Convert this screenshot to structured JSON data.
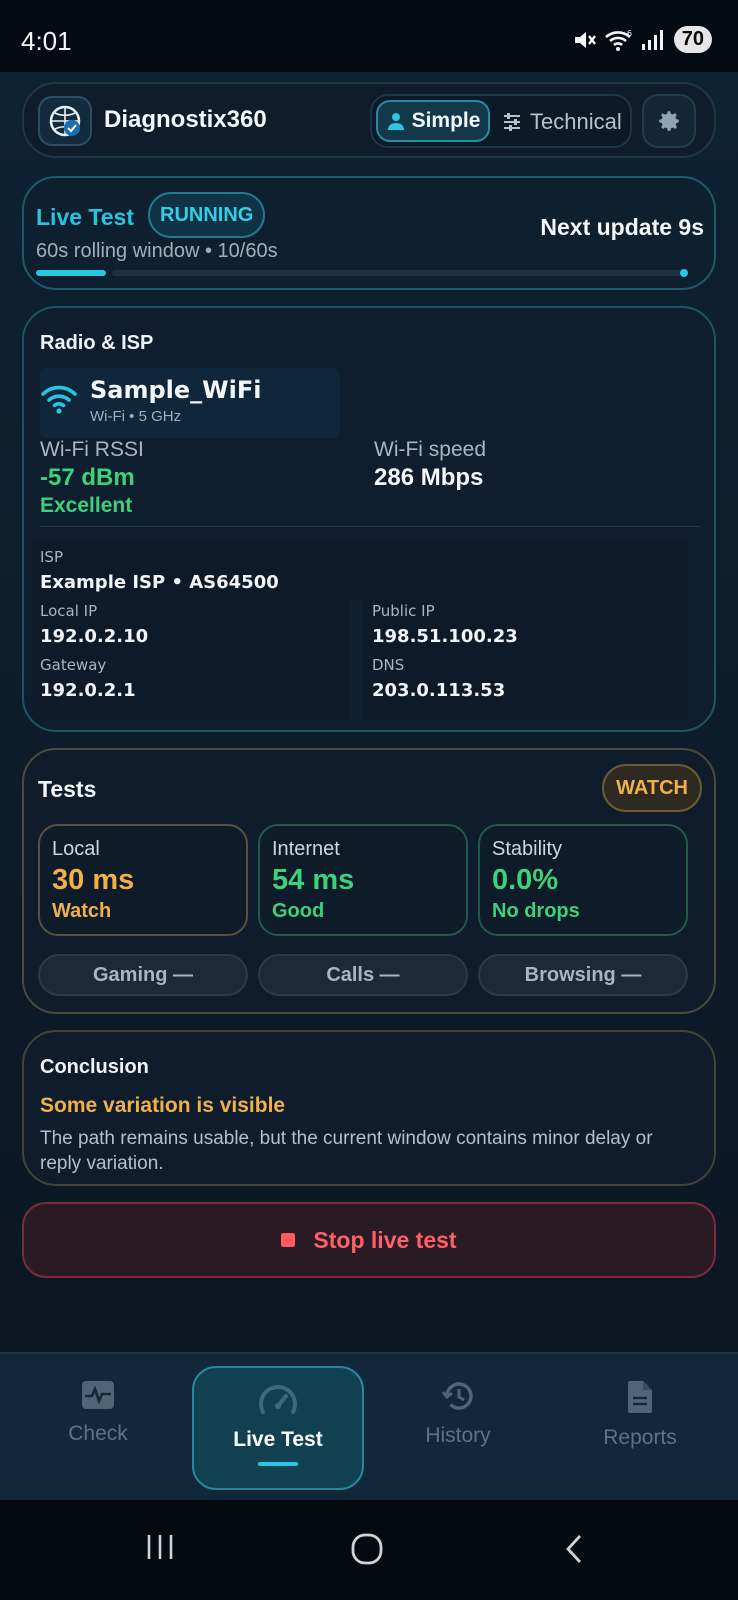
{
  "status_bar": {
    "time": "4:01",
    "battery": "70",
    "icons": [
      "mute-icon",
      "wifi-6-icon",
      "signal-icon"
    ]
  },
  "header": {
    "app_name": "Diagnostix360",
    "mode_simple": "Simple",
    "mode_technical": "Technical",
    "active_mode": "Simple",
    "icons": [
      "app-logo-icon",
      "person-icon",
      "sliders-icon",
      "gear-icon"
    ]
  },
  "live_test": {
    "label": "Live Test",
    "status": "RUNNING",
    "window": "60s rolling window • 10/60s",
    "next_update": "Next update 9s",
    "progress": 0.167
  },
  "radio": {
    "title": "Radio & ISP",
    "ssid": "Sample_WiFi",
    "band": "Wi-Fi • 5 GHz",
    "rssi_label": "Wi-Fi RSSI",
    "rssi_value": "-57 dBm",
    "rssi_quality": "Excellent",
    "speed_label": "Wi-Fi speed",
    "speed_value": "286 Mbps",
    "isp_label": "ISP",
    "isp_value": "Example ISP • AS64500",
    "local_ip_label": "Local IP",
    "local_ip": "192.0.2.10",
    "public_ip_label": "Public IP",
    "public_ip": "198.51.100.23",
    "gateway_label": "Gateway",
    "gateway": "192.0.2.1",
    "dns_label": "DNS",
    "dns": "203.0.113.53"
  },
  "tests": {
    "title": "Tests",
    "badge": "WATCH",
    "tiles": [
      {
        "label": "Local",
        "value": "30 ms",
        "status": "Watch",
        "color": "#f2b04a"
      },
      {
        "label": "Internet",
        "value": "54 ms",
        "status": "Good",
        "color": "#3ed07a"
      },
      {
        "label": "Stability",
        "value": "0.0%",
        "status": "No drops",
        "color": "#3ed07a"
      }
    ],
    "pills": [
      "Gaming —",
      "Calls —",
      "Browsing —"
    ]
  },
  "conclusion": {
    "title": "Conclusion",
    "headline": "Some variation is visible",
    "body": "The path remains usable, but the current window contains minor delay or reply variation."
  },
  "stop_button": "Stop live test",
  "bottom_nav": [
    {
      "label": "Check",
      "icon": "pulse-icon",
      "active": false
    },
    {
      "label": "Live Test",
      "icon": "speedometer-icon",
      "active": true
    },
    {
      "label": "History",
      "icon": "history-icon",
      "active": false
    },
    {
      "label": "Reports",
      "icon": "document-icon",
      "active": false
    }
  ],
  "colors": {
    "accent": "#28c6e2",
    "good": "#3ed07a",
    "warn": "#f2b04a",
    "danger": "#ff5a5f"
  }
}
